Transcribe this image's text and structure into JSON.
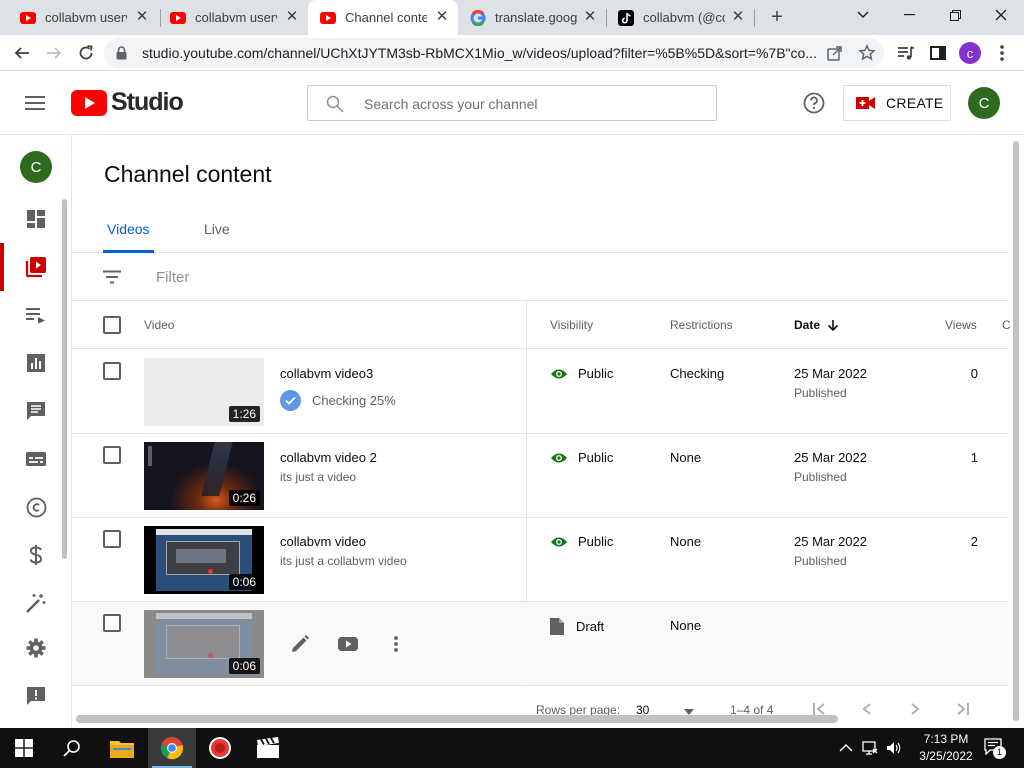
{
  "browser": {
    "tabs": [
      {
        "title": "collabvm userv",
        "favicon": "youtube-favicon",
        "active": false
      },
      {
        "title": "collabvm userv",
        "favicon": "youtube-favicon",
        "active": false
      },
      {
        "title": "Channel conten",
        "favicon": "youtube-favicon",
        "active": true
      },
      {
        "title": "translate.googl",
        "favicon": "google-favicon",
        "active": false
      },
      {
        "title": "collabvm (@col",
        "favicon": "tiktok-favicon",
        "active": false
      }
    ],
    "url": "studio.youtube.com/channel/UChXtJYTM3sb-RbMCX1Mio_w/videos/upload?filter=%5B%5D&sort=%7B\"co...",
    "profile_initial": "c",
    "profile_color": "#8430ce"
  },
  "header": {
    "logo_word": "Studio",
    "search_placeholder": "Search across your channel",
    "create_label": "CREATE",
    "avatar_initial": "C",
    "avatar_color": "#2e6b1e",
    "brand_red": "#ff0000"
  },
  "sidebar": {
    "channel_initial": "C",
    "items": [
      {
        "name": "dashboard",
        "icon": "dashboard-icon",
        "active": false
      },
      {
        "name": "content",
        "icon": "content-icon",
        "active": true
      },
      {
        "name": "playlists",
        "icon": "playlists-icon",
        "active": false
      },
      {
        "name": "analytics",
        "icon": "analytics-icon",
        "active": false
      },
      {
        "name": "comments",
        "icon": "comments-icon",
        "active": false
      },
      {
        "name": "subtitles",
        "icon": "subtitles-icon",
        "active": false
      },
      {
        "name": "copyright",
        "icon": "copyright-icon",
        "active": false
      },
      {
        "name": "earn",
        "icon": "dollar-icon",
        "active": false
      },
      {
        "name": "customisation",
        "icon": "magic-wand-icon",
        "active": false
      },
      {
        "name": "settings",
        "icon": "gear-icon",
        "active": false
      },
      {
        "name": "feedback",
        "icon": "feedback-icon",
        "active": false
      }
    ]
  },
  "main": {
    "title": "Channel content",
    "tabs": [
      {
        "label": "Videos",
        "active": true
      },
      {
        "label": "Live",
        "active": false
      }
    ],
    "filter_label": "Filter",
    "columns": {
      "video": "Video",
      "visibility": "Visibility",
      "restrictions": "Restrictions",
      "date": "Date",
      "views": "Views",
      "comments": "C"
    },
    "rows": [
      {
        "title": "collabvm video3",
        "description": "",
        "status": "Checking 25%",
        "duration": "1:26",
        "visibility": "Public",
        "restrictions": "Checking",
        "date": "25 Mar 2022",
        "date_status": "Published",
        "views": "0"
      },
      {
        "title": "collabvm video 2",
        "description": "its just a video",
        "status": "",
        "duration": "0:26",
        "visibility": "Public",
        "restrictions": "None",
        "date": "25 Mar 2022",
        "date_status": "Published",
        "views": "1"
      },
      {
        "title": "collabvm video",
        "description": "its just a collabvm video",
        "status": "",
        "duration": "0:06",
        "visibility": "Public",
        "restrictions": "None",
        "date": "25 Mar 2022",
        "date_status": "Published",
        "views": "2"
      },
      {
        "title": "",
        "description": "",
        "status": "",
        "duration": "0:06",
        "visibility": "Draft",
        "restrictions": "None",
        "date": "",
        "date_status": "",
        "views": ""
      }
    ],
    "footer": {
      "rows_per_page_label": "Rows per page:",
      "rows_per_page": "30",
      "range": "1–4 of 4"
    },
    "accent": "#065fd4",
    "public_color": "#107516"
  },
  "taskbar": {
    "time": "7:13 PM",
    "date": "3/25/2022",
    "notification_count": "1"
  }
}
